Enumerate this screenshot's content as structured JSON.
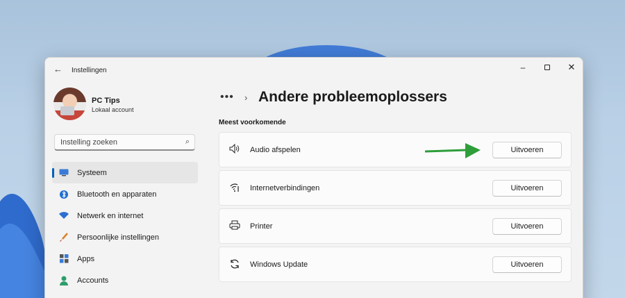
{
  "window": {
    "title": "Instellingen"
  },
  "profile": {
    "name": "PC Tips",
    "account_type": "Lokaal account"
  },
  "search": {
    "placeholder": "Instelling zoeken",
    "icon": "search-icon"
  },
  "nav": {
    "items": [
      {
        "label": "Systeem",
        "icon": "system-monitor-icon",
        "active": true
      },
      {
        "label": "Bluetooth en apparaten",
        "icon": "bluetooth-icon"
      },
      {
        "label": "Netwerk en internet",
        "icon": "wifi-icon"
      },
      {
        "label": "Persoonlijke instellingen",
        "icon": "paintbrush-icon"
      },
      {
        "label": "Apps",
        "icon": "apps-icon"
      },
      {
        "label": "Accounts",
        "icon": "person-icon"
      }
    ]
  },
  "breadcrumb": {
    "more": "•••",
    "separator": "›"
  },
  "main": {
    "title": "Andere probleemoplossers",
    "section": "Meest voorkomende",
    "troubleshooters": [
      {
        "label": "Audio afspelen",
        "icon": "speaker-icon",
        "button": "Uitvoeren"
      },
      {
        "label": "Internetverbindingen",
        "icon": "wifi-icon",
        "button": "Uitvoeren"
      },
      {
        "label": "Printer",
        "icon": "printer-icon",
        "button": "Uitvoeren"
      },
      {
        "label": "Windows Update",
        "icon": "refresh-icon",
        "button": "Uitvoeren"
      }
    ]
  },
  "colors": {
    "accent": "#005fb8",
    "annotation_arrow": "#2e9e3a"
  }
}
